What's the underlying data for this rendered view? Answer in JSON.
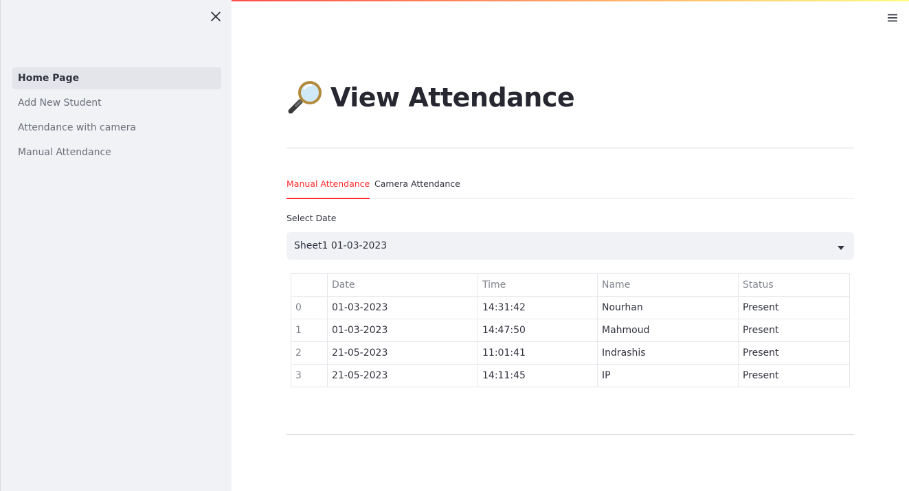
{
  "sidebar": {
    "items": [
      {
        "label": "Home Page",
        "active": true
      },
      {
        "label": "Add New Student",
        "active": false
      },
      {
        "label": "Attendance with camera",
        "active": false
      },
      {
        "label": "Manual Attendance",
        "active": false
      }
    ],
    "close_icon": "close-icon"
  },
  "header": {
    "menu_icon": "hamburger-menu-icon",
    "accent_gradient": [
      "#ff4b4b",
      "#fffd80"
    ]
  },
  "main": {
    "title_icon": "magnifying-glass-icon",
    "title": "View Attendance",
    "tabs": [
      {
        "label": "Manual Attendance",
        "active": true
      },
      {
        "label": "Camera Attendance",
        "active": false
      }
    ],
    "select": {
      "label": "Select Date",
      "value": "Sheet1 01-03-2023"
    },
    "table": {
      "columns": [
        "",
        "Date",
        "Time",
        "Name",
        "Status"
      ],
      "rows": [
        [
          "0",
          "01-03-2023",
          "14:31:42",
          "Nourhan",
          "Present"
        ],
        [
          "1",
          "01-03-2023",
          "14:47:50",
          "Mahmoud",
          "Present"
        ],
        [
          "2",
          "21-05-2023",
          "11:01:41",
          "Indrashis",
          "Present"
        ],
        [
          "3",
          "21-05-2023",
          "14:11:45",
          "IP",
          "Present"
        ]
      ]
    }
  },
  "colors": {
    "accent": "#ff2b2b",
    "sidebar_bg": "#f0f2f6",
    "text": "#31333f"
  }
}
